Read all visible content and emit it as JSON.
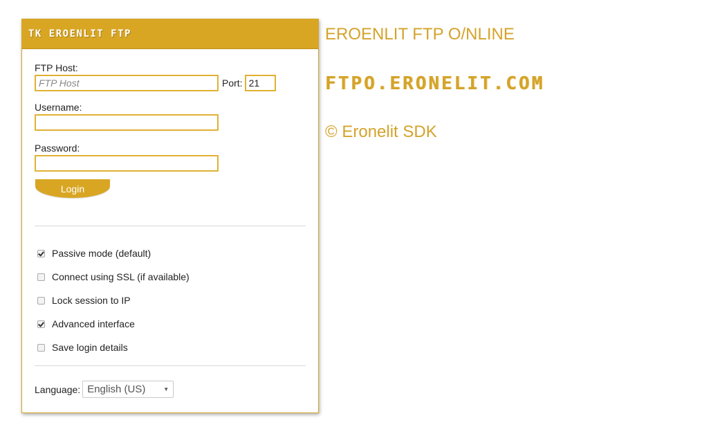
{
  "panel": {
    "title": "TK EROENLIT FTP"
  },
  "form": {
    "host_label": "FTP Host:",
    "host_placeholder": "FTP Host",
    "host_value": "",
    "port_label": "Port:",
    "port_value": "21",
    "username_label": "Username:",
    "username_value": "",
    "password_label": "Password:",
    "password_value": "",
    "login_label": "Login"
  },
  "options": [
    {
      "label": "Passive mode (default)",
      "checked": true
    },
    {
      "label": "Connect using SSL (if available)",
      "checked": false
    },
    {
      "label": "Lock session to IP",
      "checked": false
    },
    {
      "label": "Advanced interface",
      "checked": true
    },
    {
      "label": "Save login details",
      "checked": false
    }
  ],
  "language": {
    "label": "Language:",
    "selected": "English (US)"
  },
  "side": {
    "title": "EROENLIT FTP O/NLINE",
    "domain": "FTPO.ERONELIT.COM",
    "copyright": "© Eronelit SDK"
  },
  "colors": {
    "accent": "#d9a624",
    "text_accent": "#d4a32b"
  }
}
